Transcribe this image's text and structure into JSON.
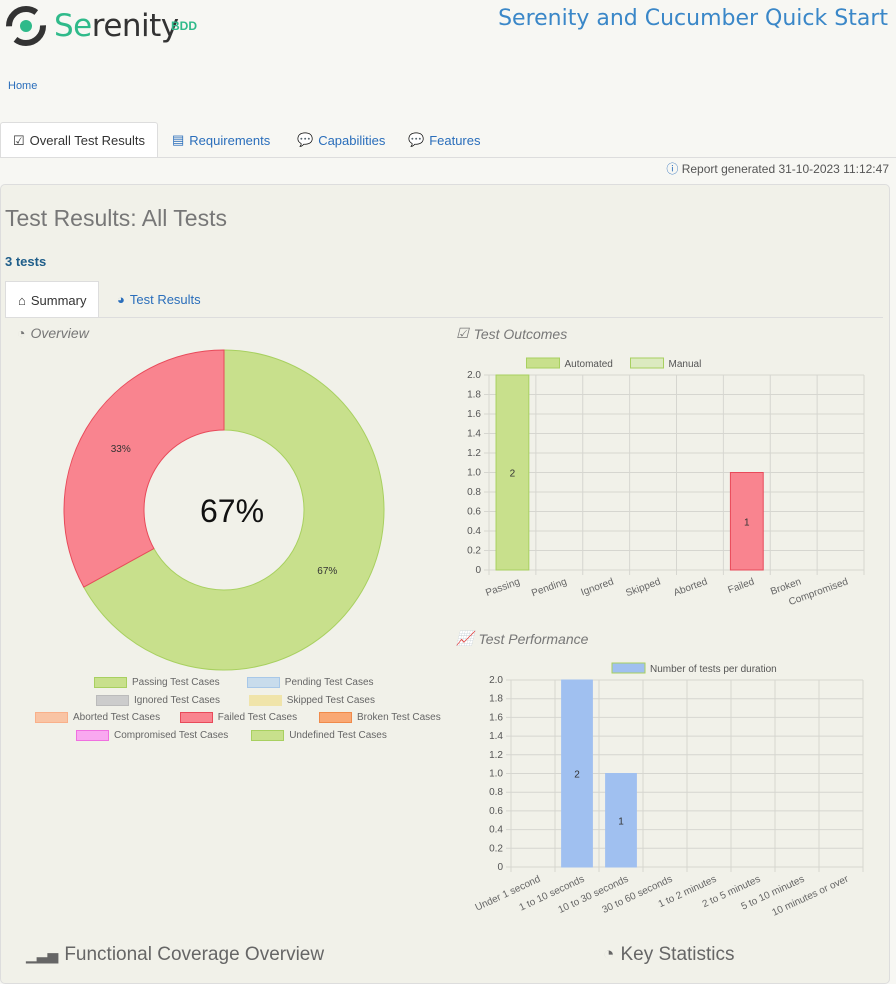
{
  "header": {
    "logo_main": "Serenity",
    "logo_sub": "BDD",
    "title": "Serenity and Cucumber Quick Start"
  },
  "breadcrumb": {
    "home": "Home"
  },
  "tabs": [
    {
      "label": "Overall Test Results",
      "icon": "checklist-icon"
    },
    {
      "label": "Requirements",
      "icon": "list-icon"
    },
    {
      "label": "Capabilities",
      "icon": "comment-icon"
    },
    {
      "label": "Features",
      "icon": "comment-icon"
    }
  ],
  "report_generated": "Report generated 31-10-2023 11:12:47",
  "main": {
    "title": "Test Results: All Tests",
    "test_count": "3 tests",
    "subtabs": [
      {
        "label": "Summary",
        "icon": "home-icon"
      },
      {
        "label": "Test Results",
        "icon": "gauge-icon"
      }
    ],
    "overview_title": "Overview",
    "outcomes_title": "Test Outcomes",
    "performance_title": "Test Performance",
    "coverage_title": "Functional Coverage Overview",
    "stats_title": "Key Statistics"
  },
  "chart_data": [
    {
      "type": "pie",
      "center_label": "67%",
      "slices": [
        {
          "label": "Passing Test Cases",
          "value": 67,
          "display": "67%",
          "color": "#c8e08c"
        },
        {
          "label": "Failed Test Cases",
          "value": 33,
          "display": "33%",
          "color": "#f9848f"
        }
      ],
      "legend": [
        {
          "label": "Passing Test Cases",
          "color": "#c8e08c",
          "border": "#a8d060"
        },
        {
          "label": "Pending Test Cases",
          "color": "#c8dcec",
          "border": "#a8c8e8"
        },
        {
          "label": "Ignored Test Cases",
          "color": "#cccccc",
          "border": "#bbbbbb"
        },
        {
          "label": "Skipped Test Cases",
          "color": "#f0e4aa",
          "border": "#f0e4aa"
        },
        {
          "label": "Aborted Test Cases",
          "color": "#f9c4a4",
          "border": "#f9b08a"
        },
        {
          "label": "Failed Test Cases",
          "color": "#f9848f",
          "border": "#e84a5a"
        },
        {
          "label": "Broken Test Cases",
          "color": "#f9a874",
          "border": "#f08a4a"
        },
        {
          "label": "Compromised Test Cases",
          "color": "#f9a8f0",
          "border": "#f070e0"
        },
        {
          "label": "Undefined Test Cases",
          "color": "#c8e08c",
          "border": "#a8d060"
        }
      ]
    },
    {
      "type": "bar",
      "categories": [
        "Passing",
        "Pending",
        "Ignored",
        "Skipped",
        "Aborted",
        "Failed",
        "Broken",
        "Compromised"
      ],
      "series": [
        {
          "name": "Automated",
          "values": [
            2,
            0,
            0,
            0,
            0,
            1,
            0,
            0
          ],
          "color": "#c8e08c"
        },
        {
          "name": "Manual",
          "values": [
            0,
            0,
            0,
            0,
            0,
            0,
            0,
            0
          ],
          "color": "#dceac0"
        }
      ],
      "bar_colors": [
        "#c8e08c",
        "",
        "",
        "",
        "",
        "#f9848f",
        "",
        ""
      ],
      "ylim": [
        0,
        2
      ],
      "yticks": [
        "0",
        "0.2",
        "0.4",
        "0.6",
        "0.8",
        "1.0",
        "1.2",
        "1.4",
        "1.6",
        "1.8",
        "2.0"
      ],
      "grid": true,
      "legend": "top"
    },
    {
      "type": "bar",
      "categories": [
        "Under 1 second",
        "1 to 10 seconds",
        "10 to 30 seconds",
        "30 to 60 seconds",
        "1 to 2 minutes",
        "2 to 5 minutes",
        "5 to 10 minutes",
        "10 minutes or over"
      ],
      "series": [
        {
          "name": "Number of tests per duration",
          "values": [
            0,
            2,
            1,
            0,
            0,
            0,
            0,
            0
          ],
          "color": "#a0c0f0"
        }
      ],
      "ylim": [
        0,
        2
      ],
      "yticks": [
        "0",
        "0.2",
        "0.4",
        "0.6",
        "0.8",
        "1.0",
        "1.2",
        "1.4",
        "1.6",
        "1.8",
        "2.0"
      ],
      "grid": true,
      "legend": "top"
    }
  ]
}
